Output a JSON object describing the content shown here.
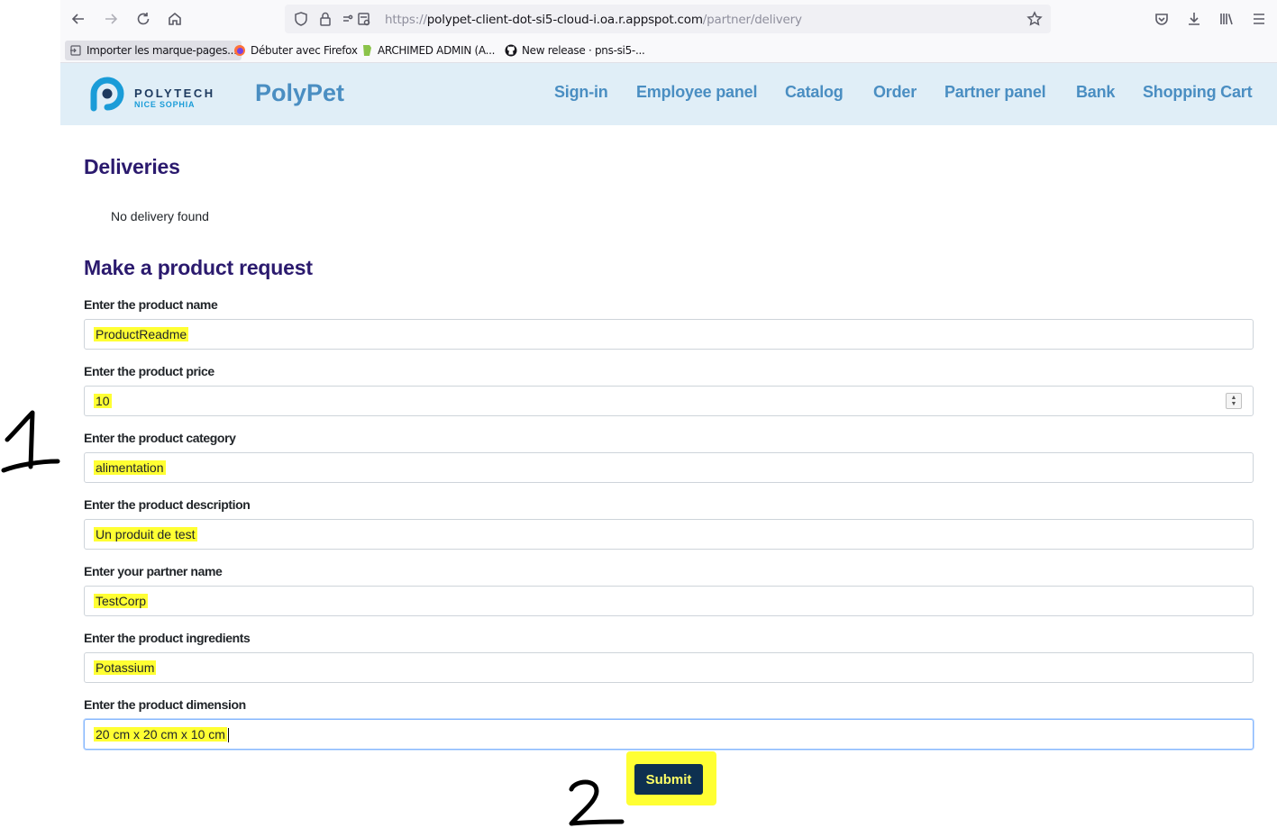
{
  "browser": {
    "url_protocol": "https://",
    "url_host": "polypet-client-dot-si5-cloud-i.oa.r.appspot.com",
    "url_path": "/partner/delivery",
    "bookmarks": [
      {
        "label": "Importer les marque-pages..."
      },
      {
        "label": "Débuter avec Firefox"
      },
      {
        "label": "ARCHIMED ADMIN (A..."
      },
      {
        "label": "New release · pns-si5-..."
      }
    ]
  },
  "header": {
    "logo_line1": "POLYTECH",
    "logo_line2": "NICE SOPHIA",
    "brand": "PolyPet",
    "nav": [
      {
        "label": "Sign-in"
      },
      {
        "label": "Employee panel"
      },
      {
        "label": "Catalog"
      },
      {
        "label": "Order"
      },
      {
        "label": "Partner panel"
      },
      {
        "label": "Bank"
      },
      {
        "label": "Shopping Cart"
      }
    ]
  },
  "deliveries": {
    "title": "Deliveries",
    "empty_message": "No delivery found"
  },
  "form": {
    "title": "Make a product request",
    "fields": [
      {
        "label": "Enter the product name",
        "value": "ProductReadme"
      },
      {
        "label": "Enter the product price",
        "value": "10"
      },
      {
        "label": "Enter the product category",
        "value": "alimentation"
      },
      {
        "label": "Enter the product description",
        "value": "Un produit de test"
      },
      {
        "label": "Enter your partner name",
        "value": "TestCorp"
      },
      {
        "label": "Enter the product ingredients",
        "value": "Potassium"
      },
      {
        "label": "Enter the product dimension",
        "value": "20 cm x 20 cm x 10 cm"
      }
    ],
    "submit_label": "Submit"
  },
  "colors": {
    "header_bg": "#e0eef7",
    "nav_link": "#4a8ec2",
    "heading": "#2b1a6e",
    "submit_bg": "#0e3050",
    "highlight": "#ffff33"
  }
}
